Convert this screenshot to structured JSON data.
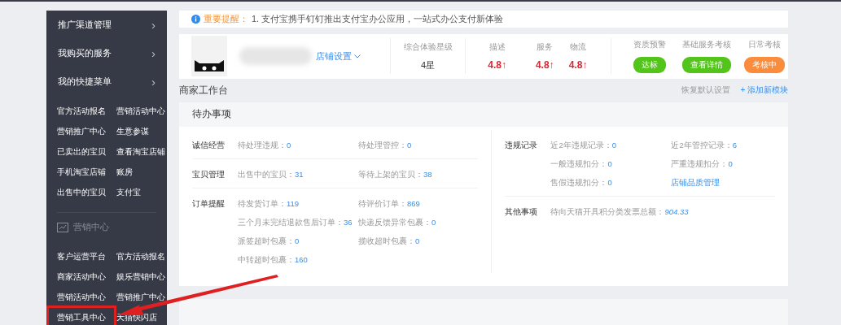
{
  "sidebar": {
    "menus": [
      {
        "label": "推广渠道管理",
        "arrow": "›"
      },
      {
        "label": "我购买的服务",
        "arrow": "›"
      },
      {
        "label": "我的快捷菜单",
        "arrow": "›"
      }
    ],
    "quick_links": [
      {
        "label": "官方活动报名"
      },
      {
        "label": "营销活动中心"
      },
      {
        "label": "营销推广中心"
      },
      {
        "label": "生意参谋"
      },
      {
        "label": "已卖出的宝贝"
      },
      {
        "label": "查看淘宝店铺"
      },
      {
        "label": "手机淘宝店铺"
      },
      {
        "label": "账房"
      },
      {
        "label": "出售中的宝贝"
      },
      {
        "label": "支付宝"
      }
    ],
    "section_title": "营销中心",
    "marketing_links": [
      {
        "label": "客户运营平台",
        "highlighted": false
      },
      {
        "label": "官方活动报名",
        "highlighted": false
      },
      {
        "label": "商家活动中心",
        "highlighted": false
      },
      {
        "label": "娱乐营销中心",
        "highlighted": false
      },
      {
        "label": "营销活动中心",
        "highlighted": false
      },
      {
        "label": "营销推广中心",
        "highlighted": false
      },
      {
        "label": "营销工具中心",
        "highlighted": true
      },
      {
        "label": "天猫快闪店",
        "highlighted": false
      }
    ]
  },
  "notice": {
    "label": "重要提醒：",
    "text": "1. 支付宝携手钉钉推出支付宝办公应用，一站式办公支付新体验"
  },
  "shop": {
    "settings_link": "店铺设置",
    "rating_label": "综合体验星级",
    "rating_value": "4星",
    "scores": [
      {
        "label": "描述",
        "value": "4.8↑"
      },
      {
        "label": "服务",
        "value": "4.8↑"
      },
      {
        "label": "物流",
        "value": "4.8↑"
      }
    ],
    "checks": [
      {
        "label": "资质预警",
        "badge": "达标",
        "color": "#52c41a"
      },
      {
        "label": "基础服务考核",
        "badge": "查看详情",
        "color": "#52c41a"
      },
      {
        "label": "日常考核",
        "badge": "考核中",
        "color": "#fa8c3c"
      }
    ]
  },
  "workbench": {
    "title": "商家工作台",
    "reset": "恢复默认设置",
    "add": "+ 添加新模块"
  },
  "todo": {
    "title": "待办事项",
    "left_groups": [
      {
        "label": "诚信经营",
        "items": [
          {
            "label": "待处理违规：",
            "value": "0"
          },
          {
            "label": "待处理管控：",
            "value": "0"
          }
        ]
      },
      {
        "label": "宝贝管理",
        "items": [
          {
            "label": "出售中的宝贝：",
            "value": "31"
          },
          {
            "label": "等待上架的宝贝：",
            "value": "38"
          }
        ]
      },
      {
        "label": "订单提醒",
        "items": [
          {
            "label": "待发货订单：",
            "value": "119"
          },
          {
            "label": "待评价订单：",
            "value": "869"
          },
          {
            "label": "三个月未完结退款售后订单：",
            "value": "36"
          },
          {
            "label": "快递反馈异常包裹：",
            "value": "0"
          },
          {
            "label": "派签超时包裹：",
            "value": "0"
          },
          {
            "label": "揽收超时包裹：",
            "value": "0"
          },
          {
            "label": "中转超时包裹：",
            "value": "160"
          }
        ]
      }
    ],
    "right_groups": [
      {
        "label": "违规记录",
        "items": [
          {
            "label": "近2年违规记录：",
            "value": "0"
          },
          {
            "label": "近2年管控记录：",
            "value": "6"
          },
          {
            "label": "一般违规扣分：",
            "value": "0"
          },
          {
            "label": "严重违规扣分：",
            "value": "0"
          },
          {
            "label": "售假违规扣分：",
            "value": "0"
          },
          {
            "link": "店铺品质管理"
          }
        ]
      },
      {
        "label": "其他事项",
        "items": [
          {
            "label": "待向天猫开具积分类发票总额：",
            "value": "904.33",
            "italic": true
          }
        ]
      }
    ]
  }
}
